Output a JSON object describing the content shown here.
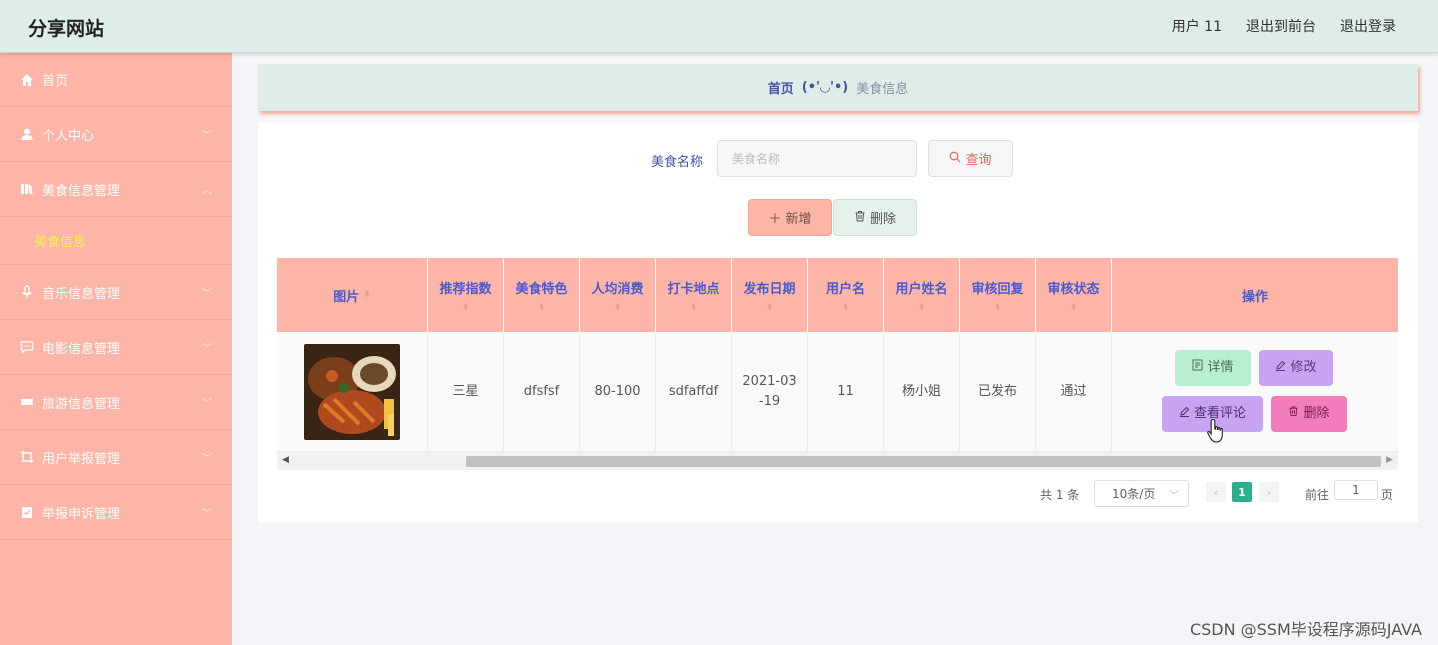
{
  "header": {
    "site_title": "分享网站",
    "user_label": "用户 11",
    "to_front": "退出到前台",
    "logout": "退出登录"
  },
  "sidebar": {
    "items": [
      {
        "label": "首页",
        "icon": "home-icon"
      },
      {
        "label": "个人中心",
        "icon": "user-icon"
      },
      {
        "label": "美食信息管理",
        "icon": "book-icon",
        "expanded": true,
        "sub": [
          "美食信息"
        ]
      },
      {
        "label": "音乐信息管理",
        "icon": "microphone-icon"
      },
      {
        "label": "电影信息管理",
        "icon": "chat-icon"
      },
      {
        "label": "旅游信息管理",
        "icon": "ticket-icon"
      },
      {
        "label": "用户举报管理",
        "icon": "crop-icon"
      },
      {
        "label": "举报申诉管理",
        "icon": "checklist-icon"
      }
    ]
  },
  "breadcrumb": {
    "home": "首页",
    "separator": "(•'◡'•)",
    "current": "美食信息"
  },
  "search": {
    "label": "美食名称",
    "placeholder": "美食名称",
    "query_button": "查询"
  },
  "actions": {
    "add": "新增",
    "delete": "删除"
  },
  "table": {
    "columns": [
      "图片",
      "推荐指数",
      "美食特色",
      "人均消费",
      "打卡地点",
      "发布日期",
      "用户名",
      "用户姓名",
      "审核回复",
      "审核状态",
      "操作"
    ],
    "rows": [
      {
        "recommend": "三星",
        "feature": "dfsfsf",
        "avg_cost": "80-100",
        "location": "sdfaffdf",
        "date": "2021-03-19",
        "username": "11",
        "realname": "杨小姐",
        "reply": "已发布",
        "status": "通过",
        "ops": {
          "detail": "详情",
          "edit": "修改",
          "comment": "查看评论",
          "delete": "删除"
        }
      }
    ]
  },
  "pagination": {
    "total": "共 1 条",
    "page_size": "10条/页",
    "current_page": "1",
    "goto_label": "前往",
    "goto_value": "1",
    "page_suffix": "页"
  },
  "colors": {
    "sidebar": "#fcb5a6",
    "header": "#deede7",
    "accent_text": "#4a5bd0",
    "active_page": "#2bb08e"
  },
  "watermark": "CSDN @SSM毕设程序源码JAVA"
}
